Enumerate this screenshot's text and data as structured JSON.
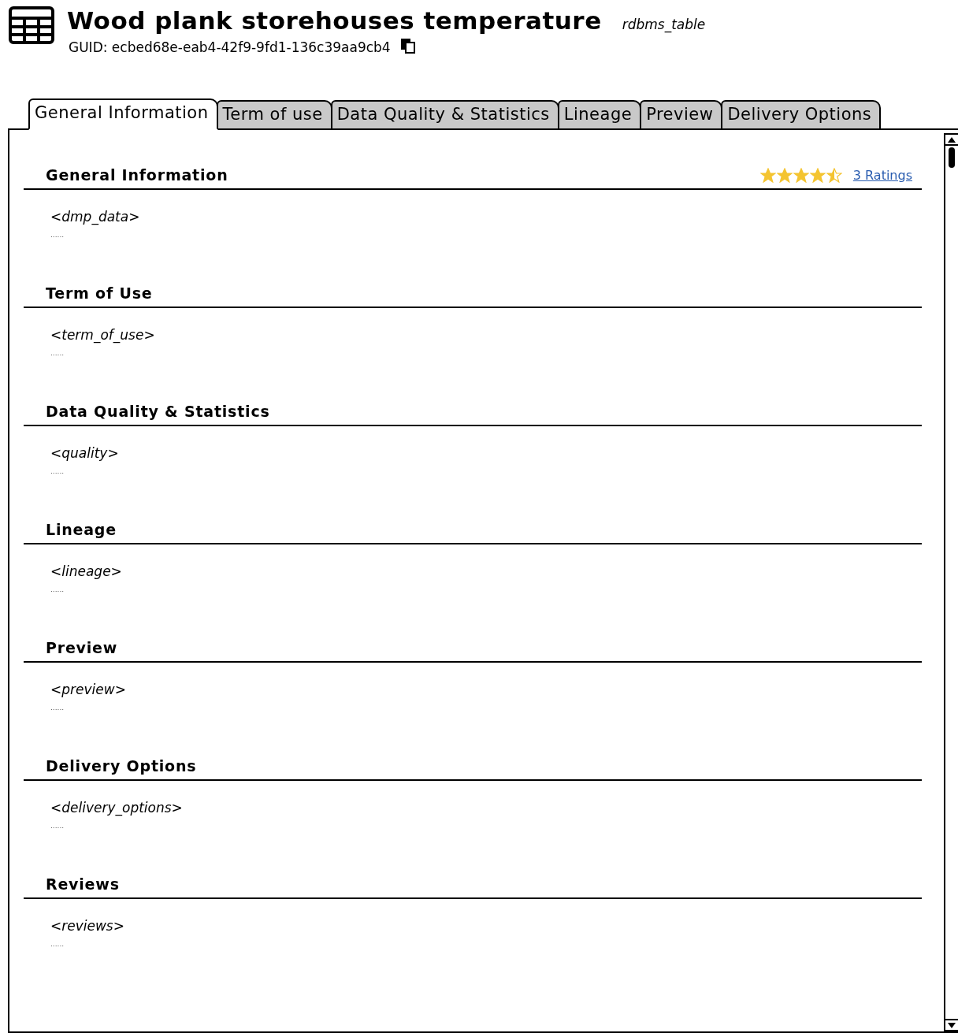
{
  "header": {
    "title": "Wood plank storehouses temperature",
    "type": "rdbms_table",
    "guid": "GUID: ecbed68e-eab4-42f9-9fd1-136c39aa9cb4"
  },
  "tabs": [
    {
      "label": "General Information",
      "selected": true
    },
    {
      "label": "Term of use",
      "selected": false
    },
    {
      "label": "Data Quality & Statistics",
      "selected": false
    },
    {
      "label": "Lineage",
      "selected": false
    },
    {
      "label": "Preview",
      "selected": false
    },
    {
      "label": "Delivery Options",
      "selected": false
    }
  ],
  "rating": {
    "stars": 4.5,
    "link": "3 Ratings"
  },
  "sections": [
    {
      "title": "General Information",
      "placeholder": "<dmp_data>",
      "more": "......"
    },
    {
      "title": "Term of Use",
      "placeholder": "<term_of_use>",
      "more": "......"
    },
    {
      "title": "Data Quality & Statistics",
      "placeholder": "<quality>",
      "more": "......"
    },
    {
      "title": "Lineage",
      "placeholder": "<lineage>",
      "more": "......"
    },
    {
      "title": "Preview",
      "placeholder": "<preview>",
      "more": "......"
    },
    {
      "title": "Delivery Options",
      "placeholder": "<delivery_options>",
      "more": "......"
    },
    {
      "title": "Reviews",
      "placeholder": "<reviews>",
      "more": "......"
    }
  ]
}
